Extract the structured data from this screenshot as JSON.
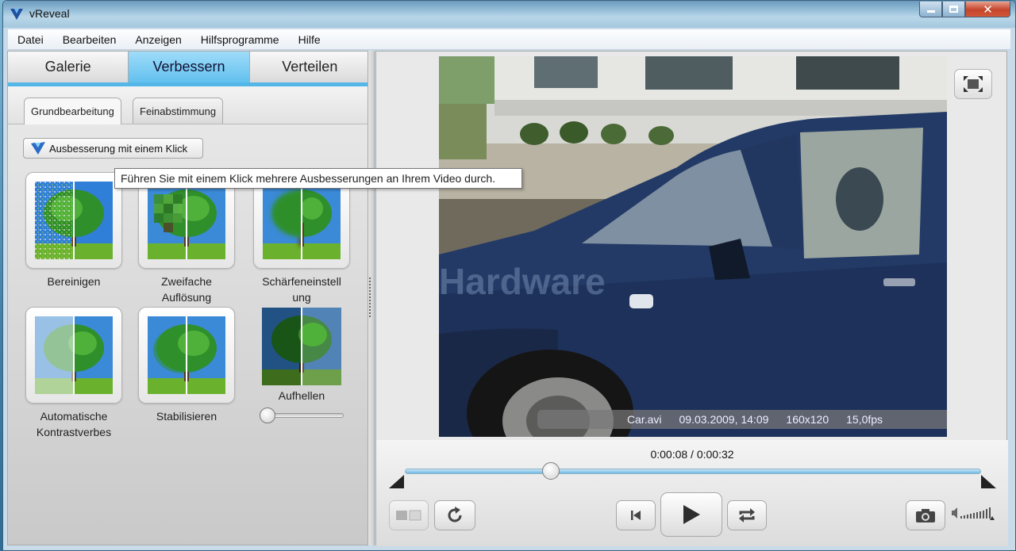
{
  "window": {
    "title": "vReveal"
  },
  "menu": [
    "Datei",
    "Bearbeiten",
    "Anzeigen",
    "Hilfsprogramme",
    "Hilfe"
  ],
  "main_tabs": [
    {
      "label": "Galerie",
      "active": false
    },
    {
      "label": "Verbessern",
      "active": true
    },
    {
      "label": "Verteilen",
      "active": false
    }
  ],
  "sub_tabs": [
    {
      "label": "Grundbearbeitung",
      "active": true
    },
    {
      "label": "Feinabstimmung",
      "active": false
    }
  ],
  "one_click": {
    "label": "Ausbesserung mit einem Klick",
    "tooltip": "Führen Sie mit einem Klick mehrere Ausbesserungen an Ihrem Video durch."
  },
  "tools": {
    "clean": "Bereinigen",
    "double_res": "Zweifache Auflösung",
    "sharpen": "Schärfeneinstell ung",
    "auto_contrast": "Automatische Kontrastverbes",
    "stabilize": "Stabilisieren",
    "brighten": "Aufhellen"
  },
  "video": {
    "filename": "Car.avi",
    "date": "09.03.2009, 14:09",
    "resolution": "160x120",
    "framerate": "15,0fps"
  },
  "playback": {
    "time": "0:00:08 / 0:00:32",
    "progress": 0.25
  },
  "colors": {
    "accent": "#55b6e8",
    "active_tab": "#62c0ee"
  }
}
